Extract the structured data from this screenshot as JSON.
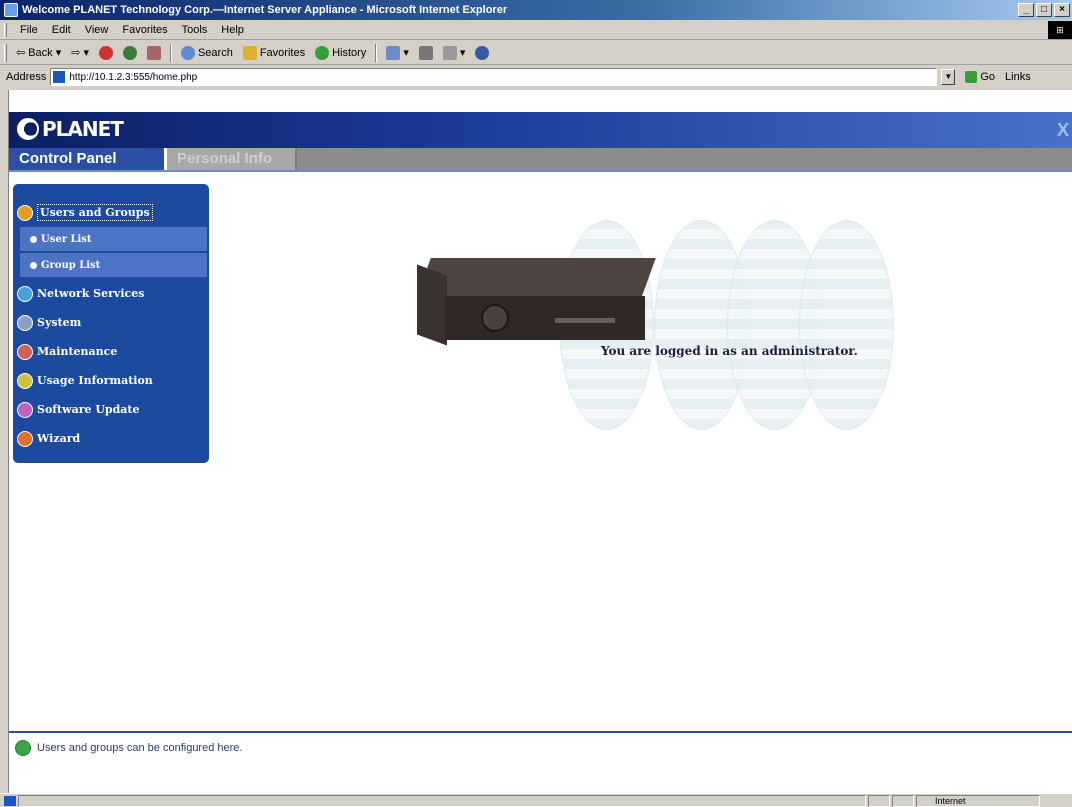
{
  "window": {
    "title": "Welcome PLANET Technology Corp.—Internet Server Appliance - Microsoft Internet Explorer",
    "controls": [
      "_",
      "□",
      "×"
    ]
  },
  "menubar": {
    "items": [
      "File",
      "Edit",
      "View",
      "Favorites",
      "Tools",
      "Help"
    ]
  },
  "toolbar": {
    "back": "Back",
    "forward": "",
    "search": "Search",
    "favorites": "Favorites",
    "history": "History"
  },
  "addressbar": {
    "label": "Address",
    "url": "http://10.1.2.3:555/home.php",
    "go": "Go",
    "links": "Links"
  },
  "app": {
    "brand": "PLANET",
    "close": "X",
    "tabs": [
      "Control Panel",
      "Personal Info"
    ],
    "nav": {
      "users_groups": "Users and Groups",
      "user_list": "User List",
      "group_list": "Group List",
      "network_services": "Network Services",
      "system": "System",
      "maintenance": "Maintenance",
      "usage_information": "Usage Information",
      "software_update": "Software Update",
      "wizard": "Wizard"
    },
    "message": "You are logged in as an administrator.",
    "hint": "Users and groups can be configured here."
  },
  "statusbar": {
    "zone": "Internet"
  },
  "colors": {
    "nav_bg": "#1b4a9e",
    "tab_active": "#2b4fa3",
    "header_dark": "#0c1f64"
  }
}
